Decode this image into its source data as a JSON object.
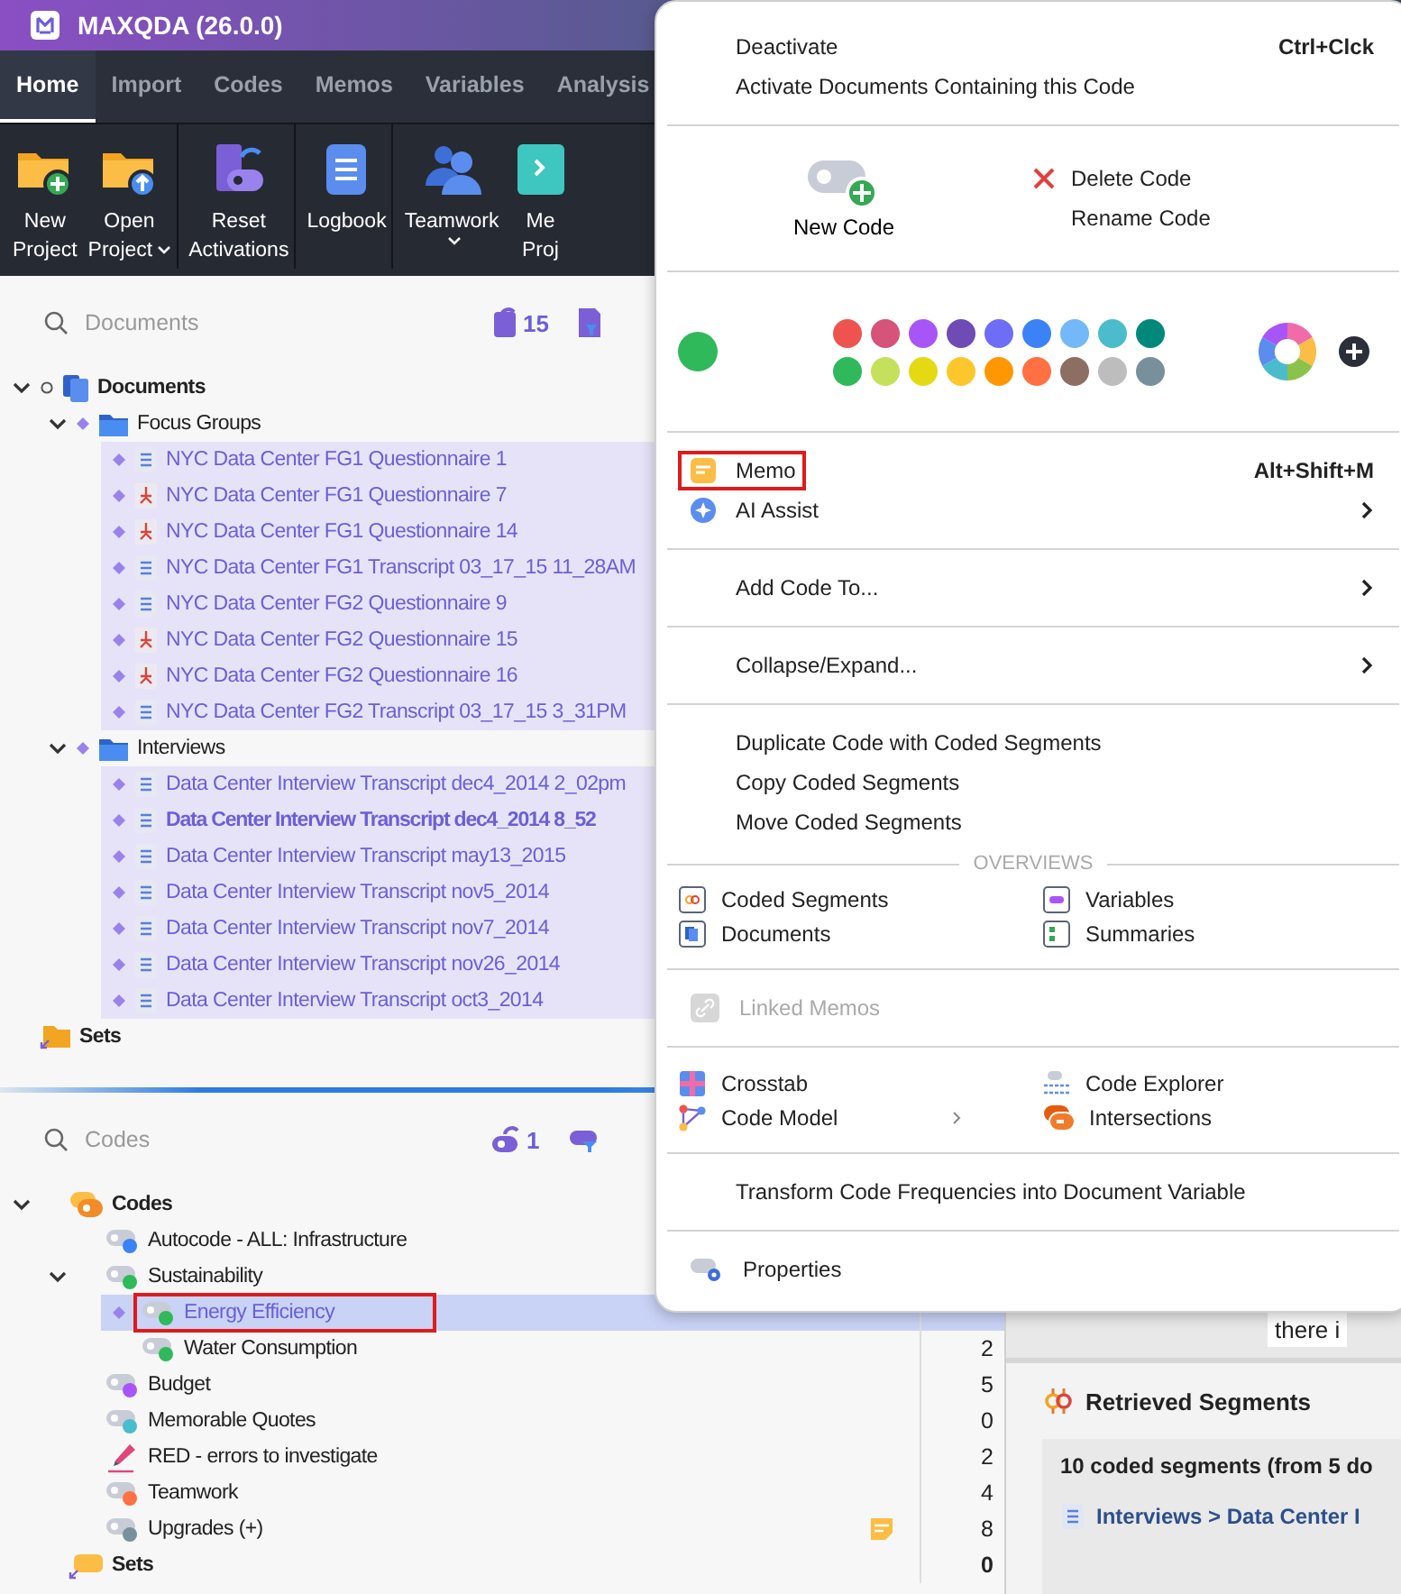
{
  "window": {
    "title": "MAXQDA (26.0.0)"
  },
  "tabs": [
    {
      "label": "Home",
      "selected": true
    },
    {
      "label": "Import",
      "selected": false
    },
    {
      "label": "Codes",
      "selected": false
    },
    {
      "label": "Memos",
      "selected": false
    },
    {
      "label": "Variables",
      "selected": false
    },
    {
      "label": "Analysis",
      "selected": false
    }
  ],
  "ribbon": [
    {
      "kind": "new-project",
      "lines": [
        "New",
        "Project"
      ],
      "dropdown": false,
      "group_end": false
    },
    {
      "kind": "open-project",
      "lines": [
        "Open",
        "Project"
      ],
      "dropdown": true,
      "group_end": true
    },
    {
      "kind": "reset",
      "lines": [
        "Reset",
        "Activations"
      ],
      "dropdown": false,
      "group_end": true
    },
    {
      "kind": "logbook",
      "lines": [
        "Logbook"
      ],
      "dropdown": false,
      "group_end": true
    },
    {
      "kind": "teamwork",
      "lines": [
        "Teamwork"
      ],
      "dropdown": true,
      "group_end": false
    },
    {
      "kind": "teal",
      "lines": [
        "Me",
        "Proj"
      ],
      "dropdown": false,
      "group_end": false
    }
  ],
  "documents_pane": {
    "search": {
      "placeholder": "Documents"
    },
    "activated_count": "15",
    "tree": [
      {
        "label": "Documents",
        "kind": "root",
        "expanded": true,
        "children": [
          {
            "label": "Focus Groups",
            "kind": "folder",
            "expanded": true,
            "children": [
              {
                "label": "NYC Data Center FG1 Questionnaire 1",
                "kind": "text",
                "activated": true
              },
              {
                "label": "NYC Data Center FG1 Questionnaire 7",
                "kind": "pdf",
                "activated": true
              },
              {
                "label": "NYC Data Center FG1 Questionnaire 14",
                "kind": "pdf",
                "activated": true
              },
              {
                "label": "NYC Data Center FG1 Transcript 03_17_15 11_28AM",
                "kind": "text",
                "activated": true
              },
              {
                "label": "NYC Data Center FG2 Questionnaire 9",
                "kind": "text",
                "activated": true
              },
              {
                "label": "NYC Data Center FG2 Questionnaire 15",
                "kind": "pdf",
                "activated": true
              },
              {
                "label": "NYC Data Center FG2 Questionnaire 16",
                "kind": "pdf",
                "activated": true
              },
              {
                "label": "NYC Data Center FG2 Transcript 03_17_15 3_31PM",
                "kind": "text",
                "activated": true
              }
            ]
          },
          {
            "label": "Interviews",
            "kind": "folder",
            "expanded": true,
            "children": [
              {
                "label": "Data Center Interview Transcript dec4_2014 2_02pm",
                "kind": "text",
                "activated": true
              },
              {
                "label": "Data Center Interview Transcript dec4_2014 8_52",
                "kind": "text",
                "activated": true,
                "open": true
              },
              {
                "label": "Data Center Interview Transcript may13_2015",
                "kind": "text",
                "activated": true
              },
              {
                "label": "Data Center Interview Transcript nov5_2014",
                "kind": "text",
                "activated": true
              },
              {
                "label": "Data Center Interview Transcript nov7_2014",
                "kind": "text",
                "activated": true
              },
              {
                "label": "Data Center Interview Transcript nov26_2014",
                "kind": "text",
                "activated": true
              },
              {
                "label": "Data Center Interview Transcript oct3_2014",
                "kind": "text",
                "activated": true
              }
            ]
          }
        ]
      },
      {
        "label": "Sets",
        "kind": "sets"
      }
    ]
  },
  "codes_pane": {
    "search": {
      "placeholder": "Codes"
    },
    "activated_count": "1",
    "tree": [
      {
        "label": "Codes",
        "kind": "root",
        "expanded": true,
        "children": [
          {
            "label": "Autocode - ALL: Infrastructure",
            "kind": "code",
            "color": "#3b82f6",
            "selected": false
          },
          {
            "label": "Sustainability",
            "kind": "code",
            "color": "#2fb95a",
            "selected": false,
            "expanded": true,
            "children": [
              {
                "label": "Energy Efficiency",
                "kind": "code",
                "color": "#2fb95a",
                "selected": true,
                "highlighted": true
              },
              {
                "label": "Water Consumption",
                "kind": "code",
                "color": "#2fb95a",
                "selected": false,
                "count": "2"
              }
            ]
          },
          {
            "label": "Budget",
            "kind": "code",
            "color": "#a855f7",
            "selected": false,
            "count": "5"
          },
          {
            "label": "Memorable Quotes",
            "kind": "code",
            "color": "#4bbccc",
            "selected": false,
            "count": "0"
          },
          {
            "label": "RED - errors to investigate",
            "kind": "marker",
            "color": "#e0457b",
            "selected": false,
            "count": "2"
          },
          {
            "label": "Teamwork",
            "kind": "code",
            "color": "#ff7043",
            "selected": false,
            "count": "4"
          },
          {
            "label": "Upgrades (+)",
            "kind": "code",
            "color": "#78909c",
            "selected": false,
            "count": "8",
            "memo": true
          }
        ]
      },
      {
        "label": "Sets",
        "kind": "sets",
        "count": "0"
      }
    ]
  },
  "document_text_fragment": "there i",
  "retrieved_segments": {
    "title": "Retrieved Segments",
    "summary": "10 coded segments (from 5 do",
    "path": "Interviews > Data Center I"
  },
  "context_menu": {
    "top": [
      {
        "label": "Deactivate",
        "shortcut": "Ctrl+Clck"
      },
      {
        "label": "Activate Documents Containing this Code"
      }
    ],
    "new_code": "New Code",
    "delete_code": "Delete Code",
    "rename_code": "Rename Code",
    "current": {
      "color": "#2fb95a"
    },
    "palette": [
      {
        "color": "#ef5350"
      },
      {
        "color": "#d6537a"
      },
      {
        "color": "#a855f7"
      },
      {
        "color": "#6f4bb5"
      },
      {
        "color": "#6d6ef5"
      },
      {
        "color": "#3b82f6"
      },
      {
        "color": "#74b9f7"
      },
      {
        "color": "#4bbccc"
      },
      {
        "color": "#00897b"
      },
      {
        "color": "#2fb95a"
      },
      {
        "color": "#c5e05a"
      },
      {
        "color": "#e5d914"
      },
      {
        "color": "#fcc72d"
      },
      {
        "color": "#ff9800"
      },
      {
        "color": "#ff7043"
      },
      {
        "color": "#8d6e63"
      },
      {
        "color": "#bdbdbd"
      },
      {
        "color": "#78909c"
      }
    ],
    "memo": {
      "label": "Memo",
      "shortcut": "Alt+Shift+M",
      "highlighted": true
    },
    "ai_assist": {
      "label": "AI Assist"
    },
    "add_code_to": "Add Code To...",
    "collapse_expand": "Collapse/Expand...",
    "segment_actions": [
      "Duplicate Code with Coded Segments",
      "Copy Coded Segments",
      "Move Coded Segments"
    ],
    "overviews_heading": "OVERVIEWS",
    "overviews": [
      {
        "label": "Coded Segments",
        "kind": "segments"
      },
      {
        "label": "Variables",
        "kind": "variables"
      },
      {
        "label": "Documents",
        "kind": "documents"
      },
      {
        "label": "Summaries",
        "kind": "summaries"
      }
    ],
    "linked_memos": {
      "label": "Linked Memos",
      "disabled": true
    },
    "tools": [
      {
        "label": "Crosstab",
        "kind": "crosstab",
        "submenu": false
      },
      {
        "label": "Code Explorer",
        "kind": "explorer",
        "submenu": false
      },
      {
        "label": "Code Model",
        "kind": "model",
        "submenu": true
      },
      {
        "label": "Intersections",
        "kind": "intersections",
        "submenu": false
      }
    ],
    "transform": "Transform Code Frequencies into Document Variable",
    "properties": "Properties"
  }
}
